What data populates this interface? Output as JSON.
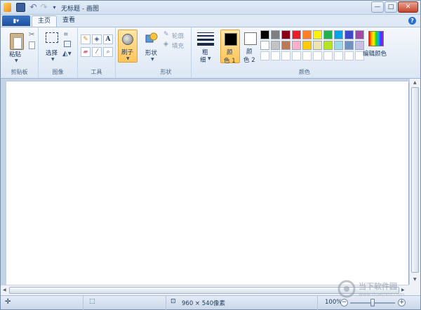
{
  "window": {
    "title": "无标题 - 画图"
  },
  "title_bar": {
    "quick_access": [
      "paint-app-icon",
      "save-icon",
      "undo-icon",
      "redo-icon",
      "customize-icon"
    ],
    "buttons": {
      "minimize": "—",
      "maximize": "□",
      "close": "✕"
    }
  },
  "tabs": {
    "menu_label": "▮▾",
    "items": [
      "主页",
      "查看"
    ],
    "help": "?"
  },
  "ribbon": {
    "clipboard": {
      "paste": "粘贴",
      "group": "剪贴板"
    },
    "image": {
      "select": "选择",
      "group": "图像"
    },
    "tools": {
      "group": "工具",
      "text_tool": "A"
    },
    "brushes": {
      "label": "刷子"
    },
    "shapes": {
      "label": "形状",
      "outline": "轮廓",
      "fill": "填充",
      "group": "形状"
    },
    "size": {
      "label_1": "粗",
      "label_2": "细"
    },
    "colors": {
      "color1_label_1": "颜",
      "color1_label_2": "色 1",
      "color2_label_1": "颜",
      "color2_label_2": "色 2",
      "edit": "编辑颜色",
      "group": "颜色",
      "color1": "#000000",
      "color2": "#ffffff",
      "palette_row1": [
        "#000000",
        "#7f7f7f",
        "#880015",
        "#ed1c24",
        "#ff7f27",
        "#fff200",
        "#22b14c",
        "#00a2e8",
        "#3f48cc",
        "#a349a4"
      ],
      "palette_row2": [
        "#ffffff",
        "#c3c3c3",
        "#b97a57",
        "#ffaec9",
        "#ffc90e",
        "#efe4b0",
        "#b5e61d",
        "#99d9ea",
        "#7092be",
        "#c8bfe7"
      ],
      "palette_row3": [
        "#ffffff",
        "#ffffff",
        "#ffffff",
        "#ffffff",
        "#ffffff",
        "#ffffff",
        "#ffffff",
        "#ffffff",
        "#ffffff",
        "#ffffff"
      ]
    }
  },
  "status": {
    "dimensions": "960 × 540像素",
    "zoom": "100%",
    "zoom_out": "−",
    "zoom_in": "+",
    "zoom_level": 0.5
  },
  "watermark": {
    "text": "当下软件园",
    "url": "www.downxia.com"
  }
}
